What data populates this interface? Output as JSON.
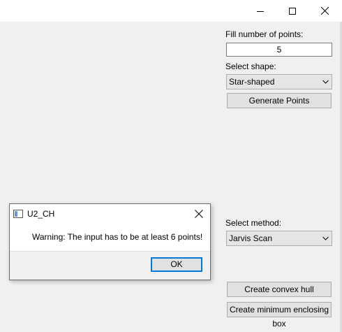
{
  "window": {
    "controls": {
      "minimize_icon": "minimize-icon",
      "maximize_icon": "maximize-icon",
      "close_icon": "close-icon"
    }
  },
  "panel": {
    "points_label": "Fill number of points:",
    "points_value": "5",
    "shape_label": "Select shape:",
    "shape_selected": "Star-shaped",
    "generate_button": "Generate Points",
    "method_label": "Select method:",
    "method_selected": "Jarvis Scan",
    "convex_hull_button": "Create convex hull",
    "enclosing_box_button": "Create minimum enclosing box"
  },
  "dialog": {
    "title": "U2_CH",
    "message": "Warning: The input has to be at least 6 points!",
    "ok_button": "OK"
  },
  "colors": {
    "window_bg": "#f0f0f0",
    "ok_focus_border": "#0078d7"
  }
}
